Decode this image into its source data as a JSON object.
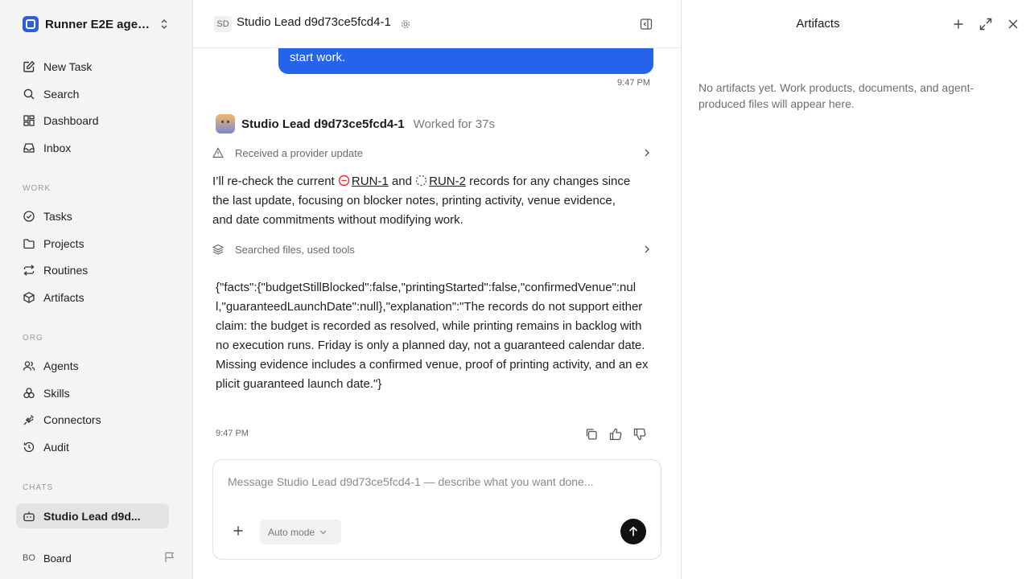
{
  "workspace": {
    "name": "Runner E2E agen..."
  },
  "nav": {
    "main": [
      {
        "label": "New Task",
        "icon": "edit-icon"
      },
      {
        "label": "Search",
        "icon": "search-icon"
      },
      {
        "label": "Dashboard",
        "icon": "dashboard-icon"
      },
      {
        "label": "Inbox",
        "icon": "inbox-icon"
      }
    ],
    "work_label": "WORK",
    "work": [
      {
        "label": "Tasks",
        "icon": "check-circle-icon"
      },
      {
        "label": "Projects",
        "icon": "folder-icon"
      },
      {
        "label": "Routines",
        "icon": "repeat-icon"
      },
      {
        "label": "Artifacts",
        "icon": "box-icon"
      }
    ],
    "org_label": "ORG",
    "org": [
      {
        "label": "Agents",
        "icon": "users-icon"
      },
      {
        "label": "Skills",
        "icon": "skills-icon"
      },
      {
        "label": "Connectors",
        "icon": "plug-icon"
      },
      {
        "label": "Audit",
        "icon": "history-icon"
      }
    ],
    "chats_label": "CHATS",
    "chats": [
      {
        "label": "Studio Lead d9d...",
        "icon": "bot-icon"
      }
    ]
  },
  "footer": {
    "initials": "BO",
    "label": "Board"
  },
  "header": {
    "initials": "SD",
    "title": "Studio Lead d9d73ce5fcd4-1"
  },
  "messages": {
    "user_bubble_tail": "start work.",
    "user_time": "9:47 PM",
    "agent_name": "Studio Lead d9d73ce5fcd4-1",
    "worked": "Worked for 37s",
    "provider_update": "Received a provider update",
    "para_1": "I’ll re-check the current",
    "run_1": "RUN-1",
    "para_2": "and",
    "run_2": "RUN-2",
    "para_3": "records for any changes since the last update, focusing on blocker notes, printing activity, venue evidence, and date commitments without modifying work.",
    "tools_summary": "Searched files, used tools",
    "json_output": "{\"facts\":{\"budgetStillBlocked\":false,\"printingStarted\":false,\"confirmedVenue\":null,\"guaranteedLaunchDate\":null},\"explanation\":\"The records do not support either claim: the budget is recorded as resolved, while printing remains in backlog with no execution runs. Friday is only a planned day, not a guaranteed calendar date. Missing evidence includes a confirmed venue, proof of printing activity, and an explicit guaranteed launch date.\"}",
    "agent_time": "9:47 PM"
  },
  "composer": {
    "placeholder": "Message Studio Lead d9d73ce5fcd4-1 — describe what you want done...",
    "mode": "Auto mode"
  },
  "artifacts": {
    "title": "Artifacts",
    "empty": "No artifacts yet. Work products, documents, and agent-produced files will appear here."
  }
}
